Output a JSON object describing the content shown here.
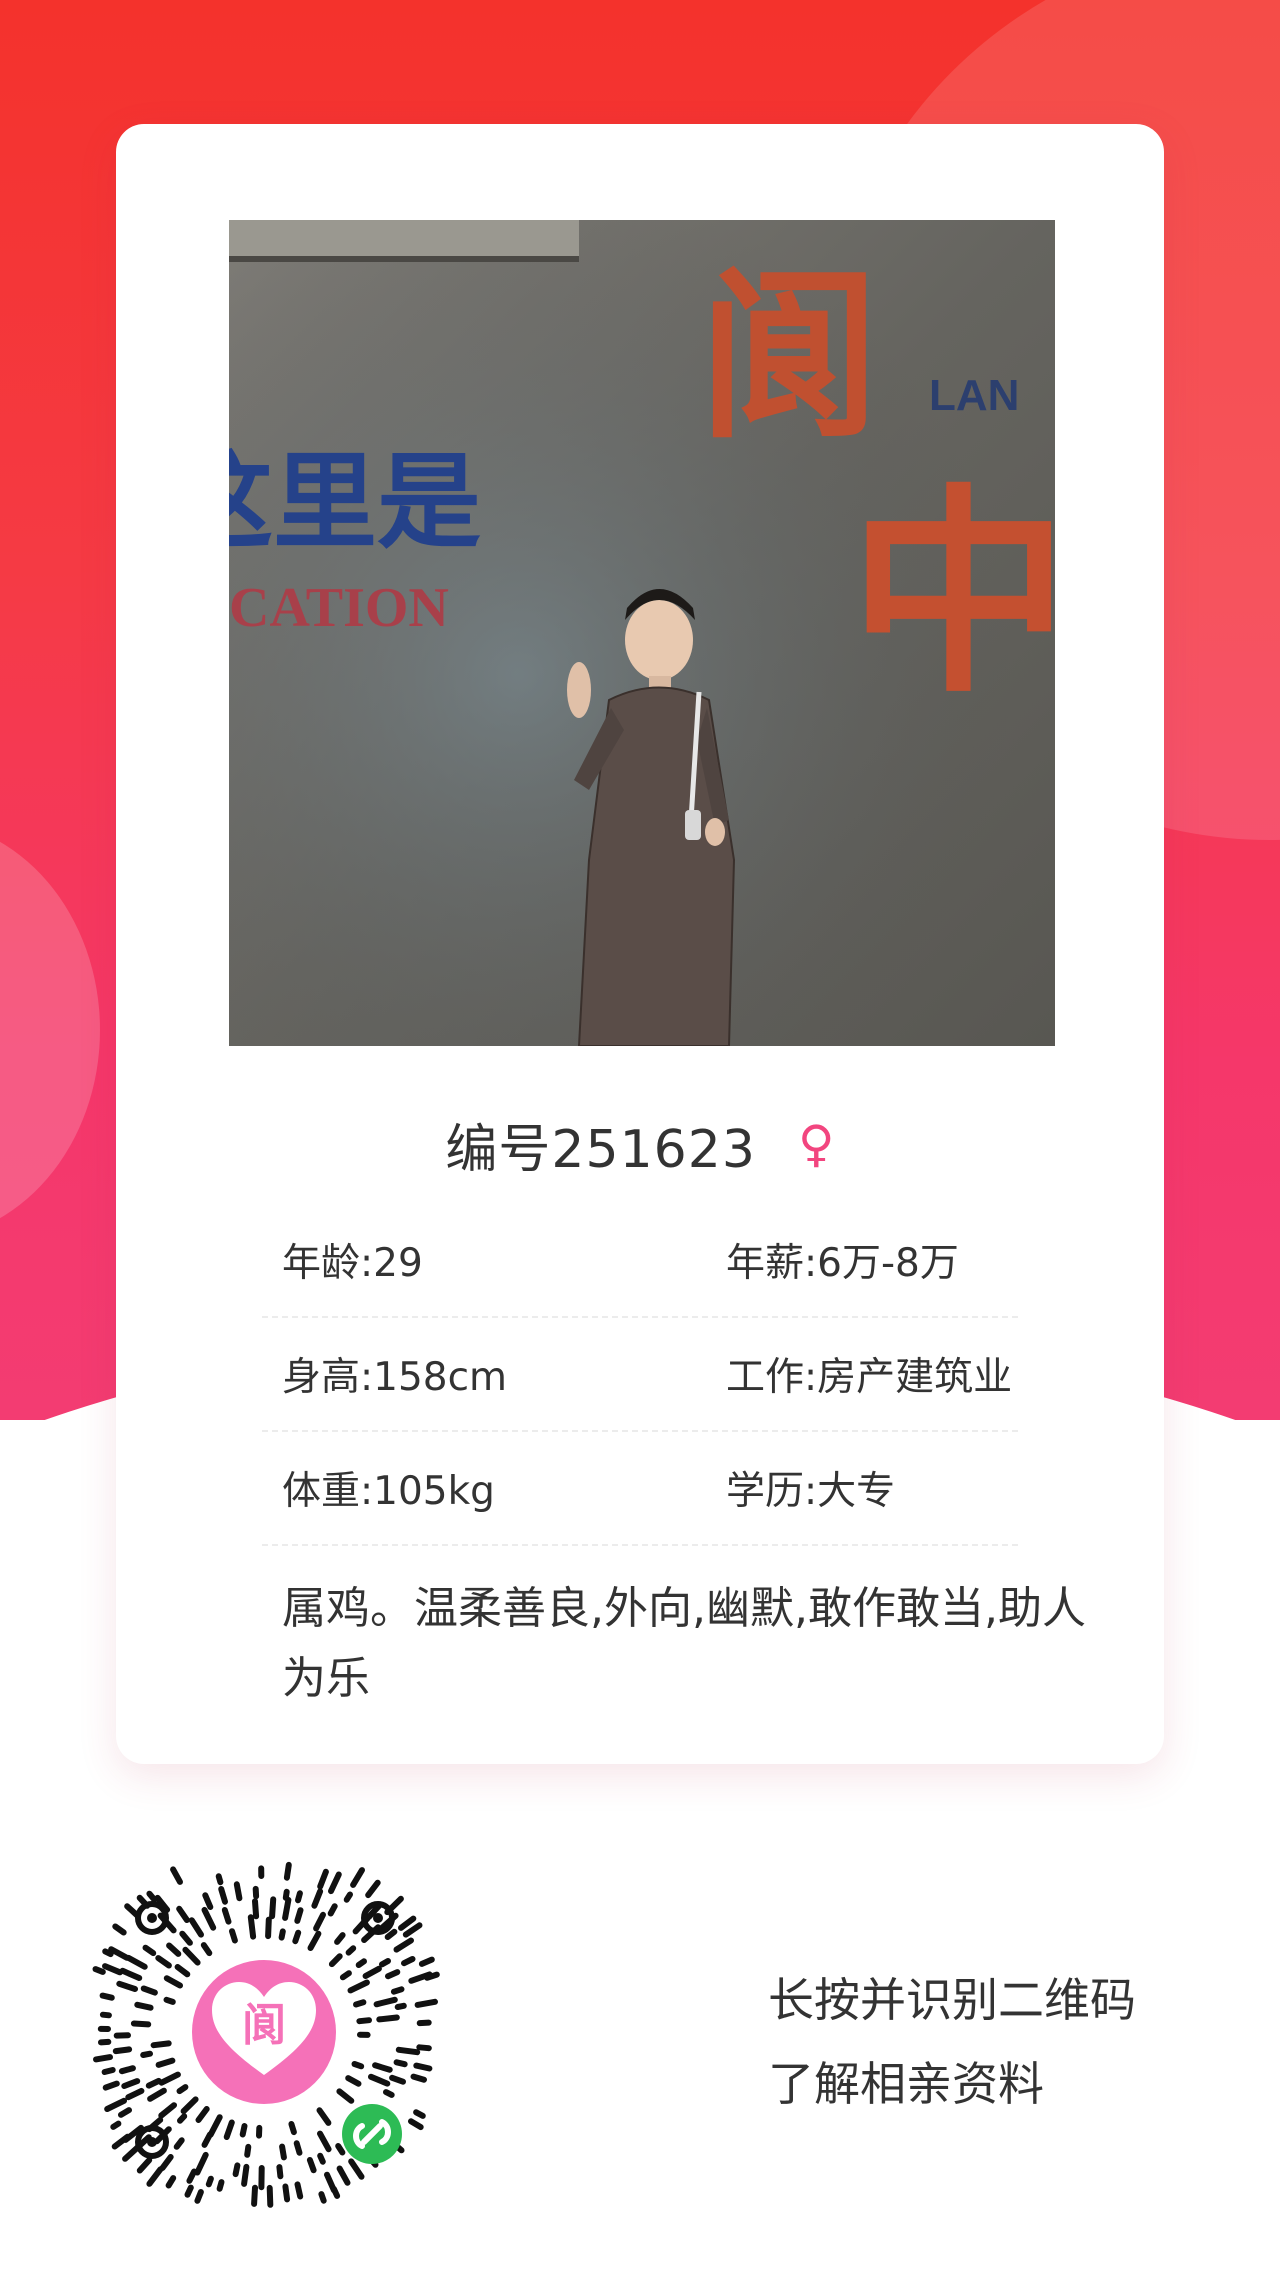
{
  "profile": {
    "id_label": "编号251623",
    "gender_symbol": "♀",
    "fields": [
      [
        "年龄:29",
        "年薪:6万-8万"
      ],
      [
        "身高:158cm",
        "工作:房产建筑业"
      ],
      [
        "体重:105kg",
        "学历:大专"
      ]
    ],
    "description": "属鸡。温柔善良,外向,幽默,敢作敢当,助人为乐"
  },
  "photo": {
    "wall_text": {
      "top_char": "阆",
      "english_top": "LAN",
      "middle_left": "这里是",
      "english_left": "CATION",
      "big_right": "中"
    }
  },
  "qr": {
    "logo_char": "阆"
  },
  "footer": {
    "line1": "长按并识别二维码",
    "line2": "了解相亲资料"
  },
  "colors": {
    "brand_red": "#f4322c",
    "brand_pink": "#f2457f",
    "wechat_green": "#2dbb55"
  }
}
